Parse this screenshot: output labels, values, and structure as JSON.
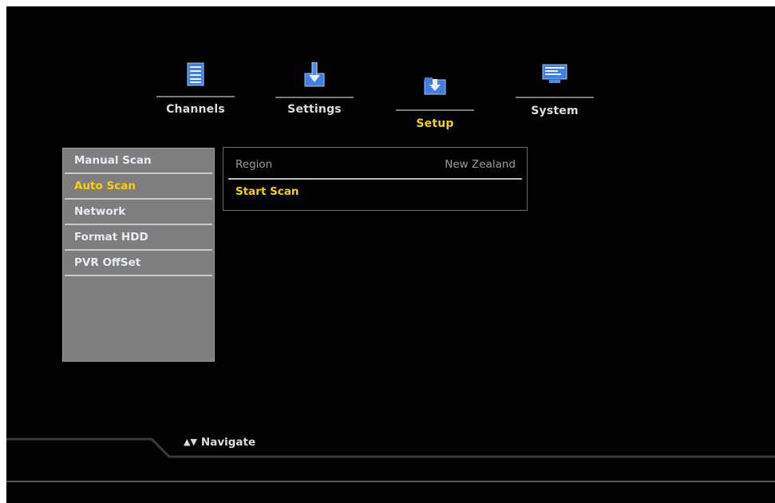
{
  "top_nav": {
    "tabs": [
      {
        "label": "Channels",
        "icon": "document-icon"
      },
      {
        "label": "Settings",
        "icon": "download-icon"
      },
      {
        "label": "Setup",
        "icon": "folder-download-icon",
        "active": true
      },
      {
        "label": "System",
        "icon": "monitor-icon"
      }
    ]
  },
  "left_menu": {
    "items": [
      {
        "label": "Manual Scan"
      },
      {
        "label": "Auto Scan",
        "active": true
      },
      {
        "label": "Network"
      },
      {
        "label": "Format HDD"
      },
      {
        "label": "PVR OffSet"
      }
    ]
  },
  "panel": {
    "region_label": "Region",
    "region_value": "New Zealand",
    "start_scan_label": "Start Scan"
  },
  "footer": {
    "navigate_label": "Navigate"
  },
  "colors": {
    "background": "#000000",
    "highlight": "#f6d200",
    "menu_bg": "#7e7e7e",
    "icon_blue": "#4a8de8"
  }
}
